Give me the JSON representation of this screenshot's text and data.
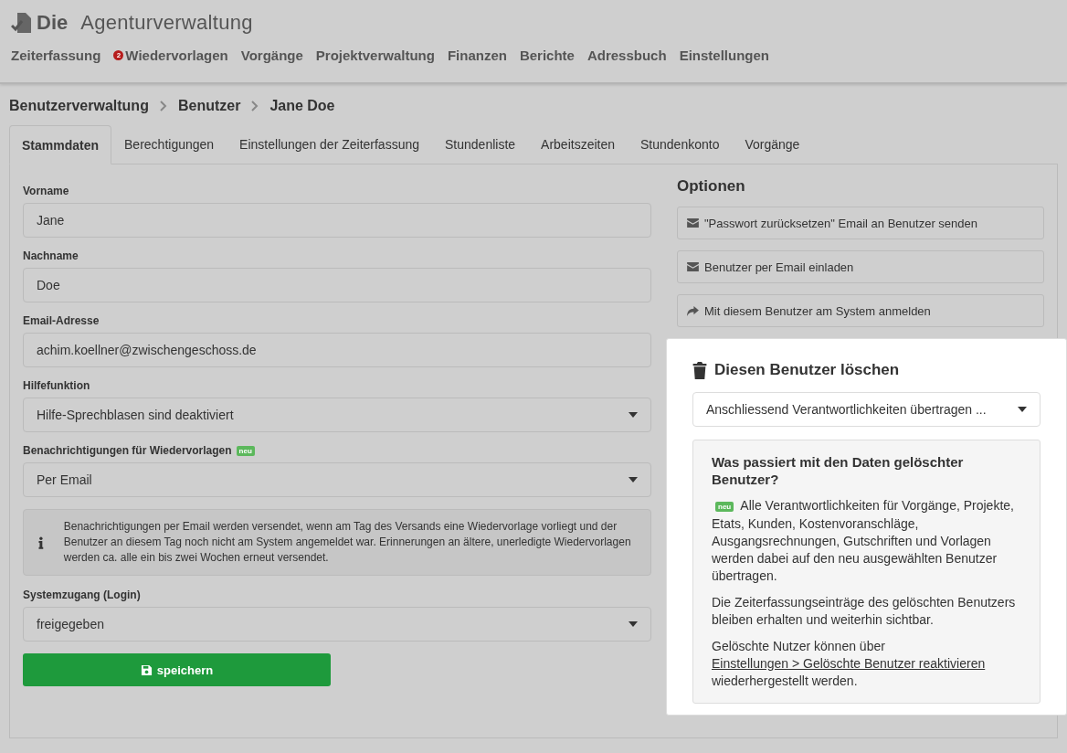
{
  "logo": {
    "prefix": "Die",
    "name": "Agenturverwaltung"
  },
  "nav": [
    {
      "label": "Zeiterfassung"
    },
    {
      "label": "Wiedervorlagen",
      "badge": "2"
    },
    {
      "label": "Vorgänge"
    },
    {
      "label": "Projektverwaltung"
    },
    {
      "label": "Finanzen"
    },
    {
      "label": "Berichte"
    },
    {
      "label": "Adressbuch"
    },
    {
      "label": "Einstellungen"
    }
  ],
  "breadcrumb": [
    "Benutzerverwaltung",
    "Benutzer",
    "Jane Doe"
  ],
  "tabs": [
    {
      "label": "Stammdaten",
      "selected": true
    },
    {
      "label": "Berechtigungen",
      "selected": false
    },
    {
      "label": "Einstellungen der Zeiterfassung",
      "selected": false
    },
    {
      "label": "Stundenliste",
      "selected": false
    },
    {
      "label": "Arbeitszeiten",
      "selected": false
    },
    {
      "label": "Stundenkonto",
      "selected": false
    },
    {
      "label": "Vorgänge",
      "selected": false
    }
  ],
  "form": [
    {
      "kind": "text",
      "label": "Vorname",
      "value": "Jane"
    },
    {
      "kind": "text",
      "label": "Nachname",
      "value": "Doe"
    },
    {
      "kind": "text",
      "label": "Email-Adresse",
      "value": "achim.koellner@zwischengeschoss.de"
    },
    {
      "kind": "select",
      "label": "Hilfefunktion",
      "value": "Hilfe-Sprechblasen sind deaktiviert"
    },
    {
      "kind": "select",
      "label": "Benachrichtigungen für Wiedervorlagen",
      "badge": "neu",
      "value": "Per Email"
    },
    {
      "kind": "info",
      "text": "Benachrichtigungen per Email werden versendet, wenn am Tag des Versands eine Wiedervorlage vorliegt und der Benutzer an diesem Tag noch nicht am System angemeldet war. Erinnerungen an ältere, unerledigte Wiedervorlagen werden ca. alle ein bis zwei Wochen erneut versendet."
    },
    {
      "kind": "select",
      "label": "Systemzugang (Login)",
      "value": "freigegeben"
    }
  ],
  "save_button": "speichern",
  "options": {
    "title": "Optionen",
    "buttons": [
      {
        "kind": "email",
        "label": "\"Passwort zurücksetzen\" Email an Benutzer senden"
      },
      {
        "kind": "email",
        "label": "Benutzer per Email einladen"
      },
      {
        "kind": "login",
        "label": "Mit diesem Benutzer am System anmelden"
      }
    ]
  },
  "delete_panel": {
    "title": "Diesen Benutzer löschen",
    "select": "Anschliessend Verantwortlichkeiten übertragen ...",
    "info_title": "Was passiert mit den Daten gelöschter Benutzer?",
    "badge": "neu",
    "paragraph_1": "Alle Verantwortlichkeiten für Vorgänge, Projekte, Etats, Kunden, Kostenvoranschläge, Ausgangsrechnungen, Gutschriften und Vorlagen werden dabei auf den neu ausgewählten Benutzer übertragen.",
    "paragraph_2": "Die Zeiterfassungseinträge des gelöschten Benutzers bleiben erhalten und weiterhin sichtbar.",
    "paragraph_3": {
      "before": "Gelöschte Nutzer können über",
      "link": "Einstellungen > Gelöschte Benutzer reaktivieren",
      "after": "wiederhergestellt werden."
    }
  }
}
